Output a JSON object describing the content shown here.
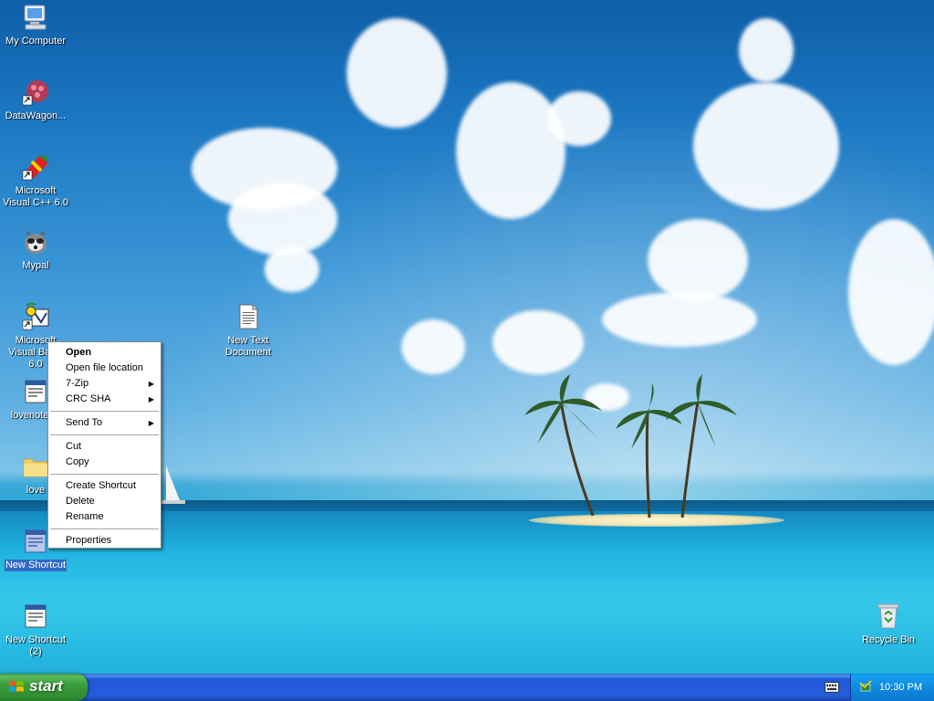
{
  "desktop": {
    "icons": [
      {
        "label": "My Computer"
      },
      {
        "label": "DataWagon..."
      },
      {
        "label": "Microsoft Visual C++ 6.0"
      },
      {
        "label": "Mypal"
      },
      {
        "label": "Microsoft Visual Basic 6.0"
      },
      {
        "label": "lovenote-..."
      },
      {
        "label": "love"
      },
      {
        "label": "New Shortcut"
      },
      {
        "label": "New Shortcut (2)"
      },
      {
        "label": "New Text Document"
      },
      {
        "label": "Recycle Bin"
      }
    ]
  },
  "context_menu": {
    "items": [
      {
        "label": "Open",
        "bold": true
      },
      {
        "label": "Open file location"
      },
      {
        "label": "7-Zip",
        "submenu": true
      },
      {
        "label": "CRC SHA",
        "submenu": true
      },
      {
        "label": "Send To",
        "submenu": true
      },
      {
        "label": "Cut"
      },
      {
        "label": "Copy"
      },
      {
        "label": "Create Shortcut"
      },
      {
        "label": "Delete"
      },
      {
        "label": "Rename"
      },
      {
        "label": "Properties"
      }
    ]
  },
  "taskbar": {
    "start_label": "start",
    "clock": "10:30 PM"
  }
}
